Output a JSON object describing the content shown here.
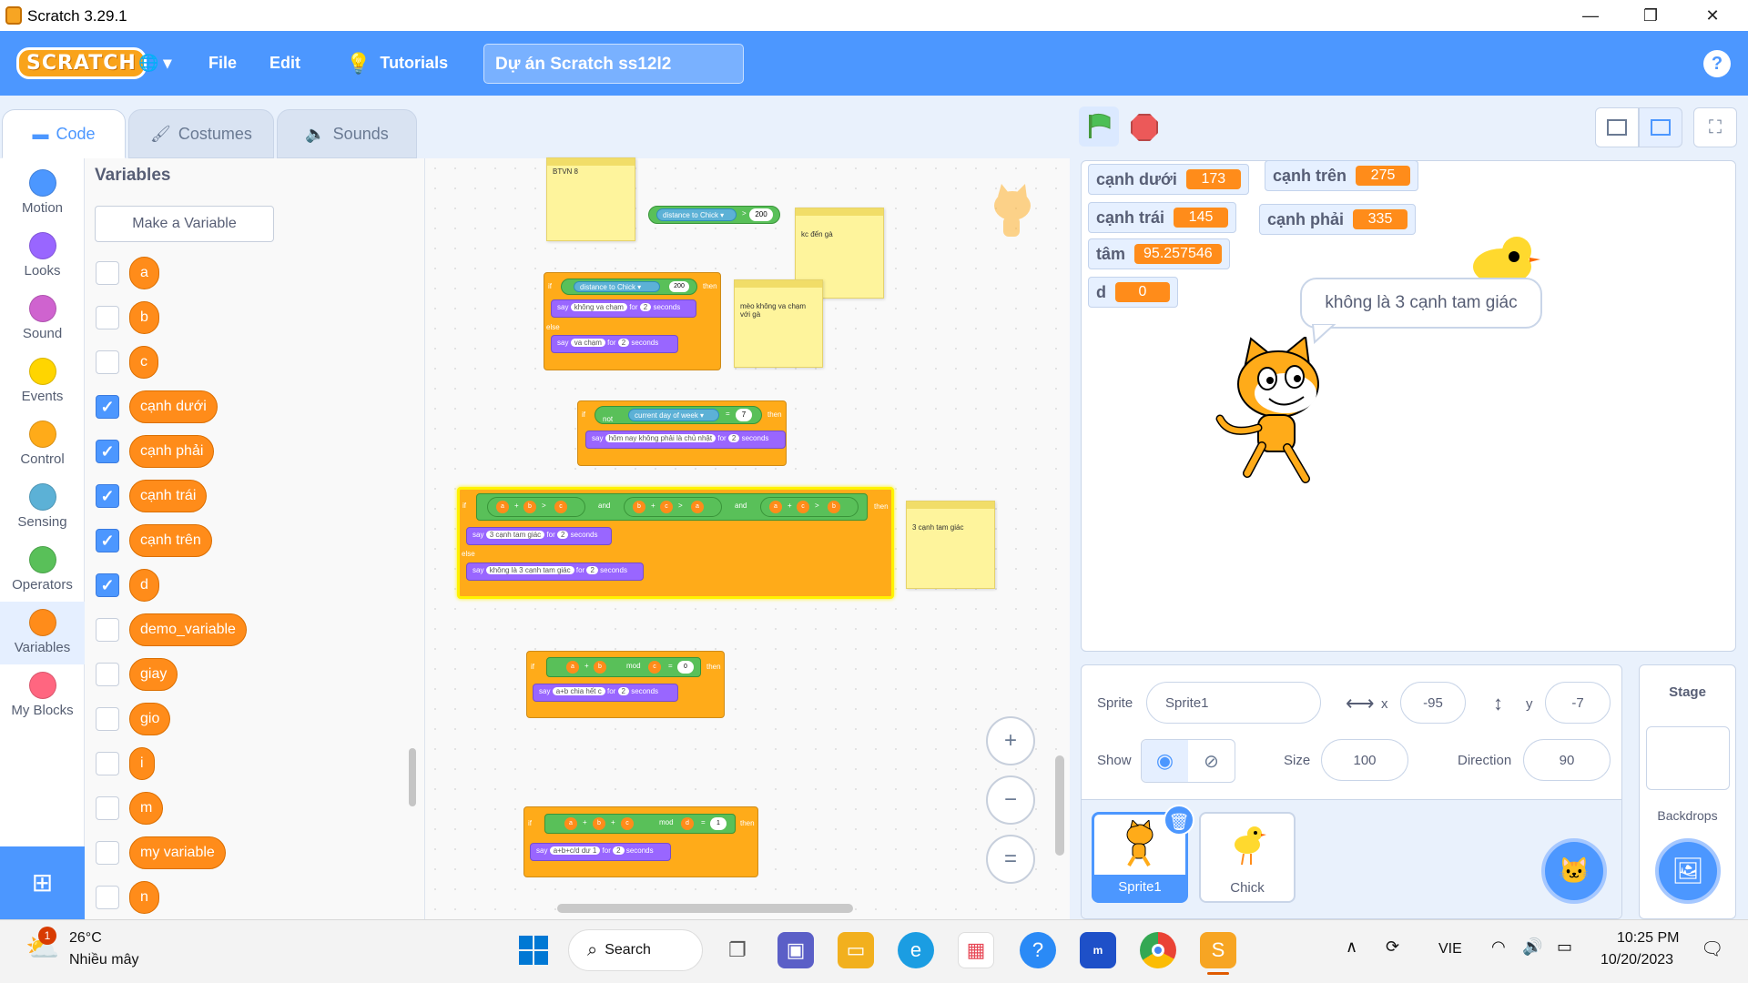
{
  "window": {
    "title": "Scratch 3.29.1",
    "minimize": "—",
    "maximize": "❐",
    "close": "✕"
  },
  "menubar": {
    "logo": "SCRATCH",
    "globe": "🌐 ▾",
    "file": "File",
    "edit": "Edit",
    "tutorials": "Tutorials",
    "project_title": "Dự án Scratch ss12l2",
    "help": "?"
  },
  "tabs": {
    "code": "Code",
    "costumes": "Costumes",
    "sounds": "Sounds"
  },
  "categories": [
    {
      "label": "Motion",
      "color": "#4c97ff"
    },
    {
      "label": "Looks",
      "color": "#9966ff"
    },
    {
      "label": "Sound",
      "color": "#cf63cf"
    },
    {
      "label": "Events",
      "color": "#ffd500"
    },
    {
      "label": "Control",
      "color": "#ffab19"
    },
    {
      "label": "Sensing",
      "color": "#5cb1d6"
    },
    {
      "label": "Operators",
      "color": "#59c059"
    },
    {
      "label": "Variables",
      "color": "#ff8c1a"
    },
    {
      "label": "My Blocks",
      "color": "#ff6680"
    }
  ],
  "palette": {
    "title": "Variables",
    "make_variable": "Make a Variable",
    "variables": [
      {
        "name": "a",
        "checked": false
      },
      {
        "name": "b",
        "checked": false
      },
      {
        "name": "c",
        "checked": false
      },
      {
        "name": "cạnh dưới",
        "checked": true
      },
      {
        "name": "cạnh phải",
        "checked": true
      },
      {
        "name": "cạnh trái",
        "checked": true
      },
      {
        "name": "cạnh trên",
        "checked": true
      },
      {
        "name": "d",
        "checked": true
      },
      {
        "name": "demo_variable",
        "checked": false
      },
      {
        "name": "giay",
        "checked": false
      },
      {
        "name": "gio",
        "checked": false
      },
      {
        "name": "i",
        "checked": false
      },
      {
        "name": "m",
        "checked": false
      },
      {
        "name": "my variable",
        "checked": false
      },
      {
        "name": "n",
        "checked": false
      }
    ]
  },
  "scripts": {
    "note1": "BTVN 8",
    "s1_distance": "distance to",
    "s1_target": "Chick ▾",
    "s1_gt": ">",
    "s1_val": "200",
    "note2": "kc đến gà",
    "s2_if": "if",
    "s2_then": "then",
    "s2_else": "else",
    "s2_say1": "không va chạm",
    "s2_say2": "va chạm",
    "say": "say",
    "for": "for",
    "secs": "seconds",
    "two": "2",
    "note3": "mèo không va chạm với gà",
    "s3_not": "not",
    "s3_current": "current",
    "s3_dow": "day of week ▾",
    "s3_eq": "=",
    "s3_val": "7",
    "s3_say": "hôm nay không phải là chủ nhật",
    "s4_and": "and",
    "s4_say1": "3 cạnh tam giác",
    "s4_say2": "không là 3 cạnh tam giác",
    "note4": "3 cạnh tam giác",
    "s5_mod": "mod",
    "s5_zero": "0",
    "s5_say": "a+b chia hết c",
    "s6_one": "1",
    "s6_say": "a+b+c/d dư 1",
    "va": "a",
    "vb": "b",
    "vc": "c",
    "vd": "d",
    "plus": "+"
  },
  "zoom": {
    "in": "+",
    "out": "−",
    "reset": "="
  },
  "stage": {
    "monitors": [
      {
        "label": "cạnh dưới",
        "value": "173"
      },
      {
        "label": "cạnh trên",
        "value": "275"
      },
      {
        "label": "cạnh trái",
        "value": "145"
      },
      {
        "label": "cạnh phải",
        "value": "335"
      },
      {
        "label": "tâm",
        "value": "95.257546"
      },
      {
        "label": "d",
        "value": "0"
      }
    ],
    "speech": "không là 3 cạnh tam giác"
  },
  "sprite_info": {
    "sprite_label": "Sprite",
    "sprite_name": "Sprite1",
    "x_label": "x",
    "x": "-95",
    "y_label": "y",
    "y": "-7",
    "show_label": "Show",
    "size_label": "Size",
    "size": "100",
    "direction_label": "Direction",
    "direction": "90"
  },
  "sprites": [
    {
      "name": "Sprite1",
      "selected": true
    },
    {
      "name": "Chick",
      "selected": false
    }
  ],
  "stage_pane": {
    "title": "Stage",
    "backdrops": "Backdrops"
  },
  "taskbar": {
    "temp": "26°C",
    "weather": "Nhiều mây",
    "badge": "1",
    "search": "Search",
    "lang": "VIE",
    "time": "10:25 PM",
    "date": "10/20/2023"
  }
}
